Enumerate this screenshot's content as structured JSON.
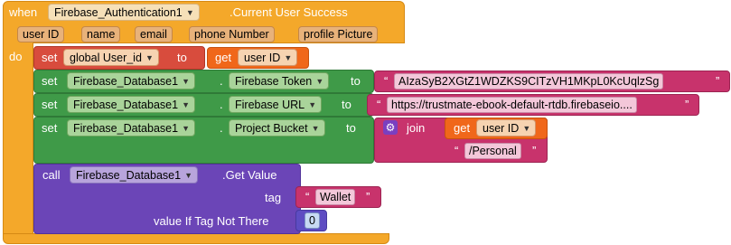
{
  "event": {
    "when_label": "when",
    "component": "Firebase_Authentication1",
    "event_name": ".Current User Success",
    "params": [
      "user ID",
      "name",
      "email",
      "phone Number",
      "profile Picture"
    ],
    "do_label": "do"
  },
  "set_global": {
    "set_label": "set",
    "variable": "global User_id",
    "to_label": "to",
    "get_label": "get",
    "get_var": "user ID"
  },
  "set_token": {
    "set_label": "set",
    "component": "Firebase_Database1",
    "dot": ".",
    "property": "Firebase Token",
    "to_label": "to",
    "value": "AIzaSyB2XGtZ1WDZKS9CITzVH1MKpL0KcUqlzSg"
  },
  "set_url": {
    "set_label": "set",
    "component": "Firebase_Database1",
    "dot": ".",
    "property": "Firebase URL",
    "to_label": "to",
    "value": "https://trustmate-ebook-default-rtdb.firebaseio...."
  },
  "set_bucket": {
    "set_label": "set",
    "component": "Firebase_Database1",
    "dot": ".",
    "property": "Project Bucket",
    "to_label": "to",
    "join_label": "join",
    "get_label": "get",
    "get_var": "user ID",
    "text2": "/Personal"
  },
  "call": {
    "call_label": "call",
    "component": "Firebase_Database1",
    "method": ".Get Value",
    "tag_label": "tag",
    "tag_value": "Wallet",
    "default_label": "value If Tag Not There",
    "default_value": "0"
  },
  "icons": {
    "dropdown": "chevron-down-icon",
    "gear": "gear-icon"
  },
  "colors": {
    "event": "#f4a82a",
    "component_set": "#3f9a48",
    "variable_set": "#f0671a",
    "text": "#c8336c",
    "procedure_call": "#6b45b7",
    "math": "#5e4cc2"
  }
}
